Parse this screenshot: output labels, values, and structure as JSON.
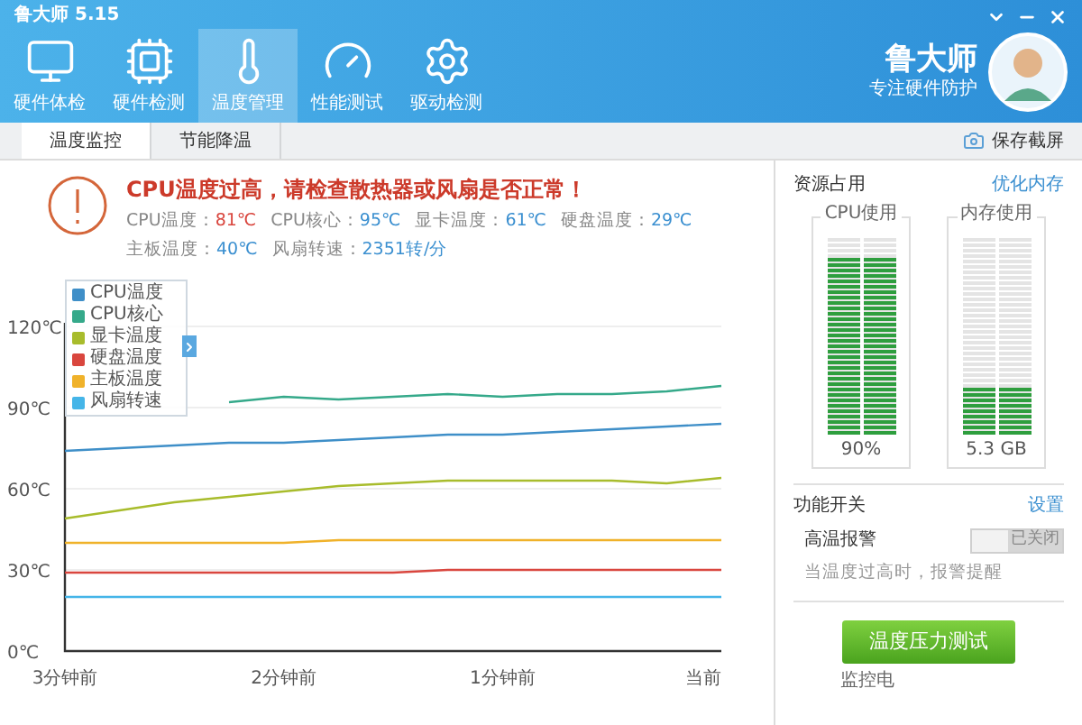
{
  "window": {
    "title": "鲁大师 5.15"
  },
  "brand": {
    "name": "鲁大师",
    "slogan": "专注硬件防护"
  },
  "nav": [
    {
      "label": "硬件体检",
      "selected": false
    },
    {
      "label": "硬件检测",
      "selected": false
    },
    {
      "label": "温度管理",
      "selected": true
    },
    {
      "label": "性能测试",
      "selected": false
    },
    {
      "label": "驱动检测",
      "selected": false
    }
  ],
  "tabs": [
    {
      "label": "温度监控",
      "selected": true
    },
    {
      "label": "节能降温",
      "selected": false
    }
  ],
  "screenshot_button": "保存截屏",
  "alert": {
    "message": "CPU温度过高，请检查散热器或风扇是否正常！",
    "rows": [
      [
        {
          "label": "CPU温度：",
          "value": "81℃",
          "color": "#d9463e"
        },
        {
          "label": "CPU核心：",
          "value": "95℃",
          "color": "#3a8fd0"
        },
        {
          "label": "显卡温度：",
          "value": "61℃",
          "color": "#3a8fd0"
        },
        {
          "label": "硬盘温度：",
          "value": "29℃",
          "color": "#3a8fd0"
        }
      ],
      [
        {
          "label": "主板温度：",
          "value": "40℃",
          "color": "#3a8fd0"
        },
        {
          "label": "风扇转速：",
          "value": "2351转/分",
          "color": "#3a8fd0"
        }
      ]
    ]
  },
  "chart": {
    "chart_data": {
      "type": "line",
      "x": [
        -3,
        -2.75,
        -2.5,
        -2.25,
        -2,
        -1.75,
        -1.5,
        -1.25,
        -1,
        -0.75,
        -0.5,
        -0.25,
        0
      ],
      "xlim": [
        -3,
        0
      ],
      "ylim": [
        0,
        120
      ],
      "grid": true,
      "legend": true,
      "xticks": [
        {
          "value": -3,
          "label": "3分钟前"
        },
        {
          "value": -2,
          "label": "2分钟前"
        },
        {
          "value": -1,
          "label": "1分钟前"
        },
        {
          "value": 0,
          "label": "当前"
        }
      ],
      "yticks": [
        {
          "value": 0,
          "label": "0℃"
        },
        {
          "value": 30,
          "label": "30℃"
        },
        {
          "value": 60,
          "label": "60℃"
        },
        {
          "value": 90,
          "label": "90℃"
        },
        {
          "value": 120,
          "label": "120℃"
        }
      ],
      "series": [
        {
          "name": "CPU温度",
          "color": "#3f8fc8",
          "values": [
            74,
            75,
            76,
            77,
            77,
            78,
            79,
            80,
            80,
            81,
            82,
            83,
            84
          ]
        },
        {
          "name": "CPU核心",
          "color": "#35a98a",
          "values": [
            null,
            null,
            null,
            92,
            94,
            93,
            94,
            95,
            94,
            95,
            95,
            96,
            98
          ]
        },
        {
          "name": "显卡温度",
          "color": "#a8bc2c",
          "values": [
            49,
            52,
            55,
            57,
            59,
            61,
            62,
            63,
            63,
            63,
            63,
            62,
            64
          ]
        },
        {
          "name": "硬盘温度",
          "color": "#d9463e",
          "values": [
            29,
            29,
            29,
            29,
            29,
            29,
            29,
            30,
            30,
            30,
            30,
            30,
            30
          ]
        },
        {
          "name": "主板温度",
          "color": "#f0b22a",
          "values": [
            40,
            40,
            40,
            40,
            40,
            41,
            41,
            41,
            41,
            41,
            41,
            41,
            41
          ]
        },
        {
          "name": "风扇转速",
          "color": "#45b5e8",
          "values": [
            20,
            20,
            20,
            20,
            20,
            20,
            20,
            20,
            20,
            20,
            20,
            20,
            20
          ]
        }
      ]
    }
  },
  "resources": {
    "title": "资源占用",
    "link": "优化内存",
    "meters": [
      {
        "label": "CPU使用",
        "level": 0.9,
        "reading": "90%"
      },
      {
        "label": "内存使用",
        "level": 0.25,
        "reading": "5.3 GB"
      }
    ]
  },
  "features": {
    "title": "功能开关",
    "link": "设置",
    "switches": [
      {
        "label": "高温报警",
        "on": false,
        "state_text": "已关闭",
        "hint": "当温度过高时，报警提醒"
      }
    ]
  },
  "stress_button": "温度压力测试",
  "footer_text": "监控电"
}
